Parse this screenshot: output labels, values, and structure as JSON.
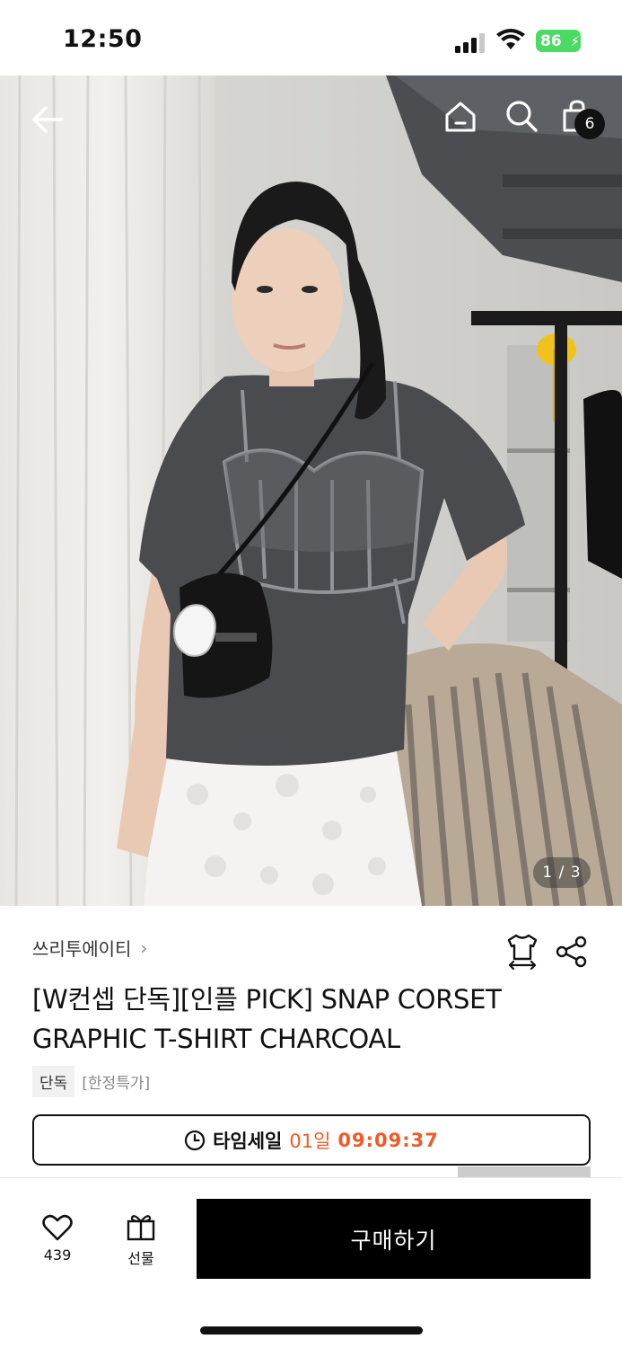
{
  "status_bar": {
    "time": "12:50",
    "battery": "86"
  },
  "hero": {
    "page_indicator": "1 / 3",
    "cart_count": "6",
    "icons": [
      "back-arrow-icon",
      "home-icon",
      "search-icon",
      "shopping-bag-icon"
    ]
  },
  "product": {
    "brand": "쓰리투에이티",
    "brand_chevron": "›",
    "title": "[W컨셉 단독][인플 PICK] SNAP CORSET GRAPHIC T-SHIRT CHARCOAL",
    "tags": [
      "단독",
      "[한정특가]"
    ],
    "timesale": {
      "label": "타임세일",
      "days": "01일",
      "time": "09:09:37"
    }
  },
  "bottom_bar": {
    "like_count": "439",
    "gift_label": "선물",
    "buy_label": "구매하기"
  },
  "colors": {
    "accent": "#f05a28",
    "battery": "#4cd964",
    "primary_button": "#000000"
  }
}
